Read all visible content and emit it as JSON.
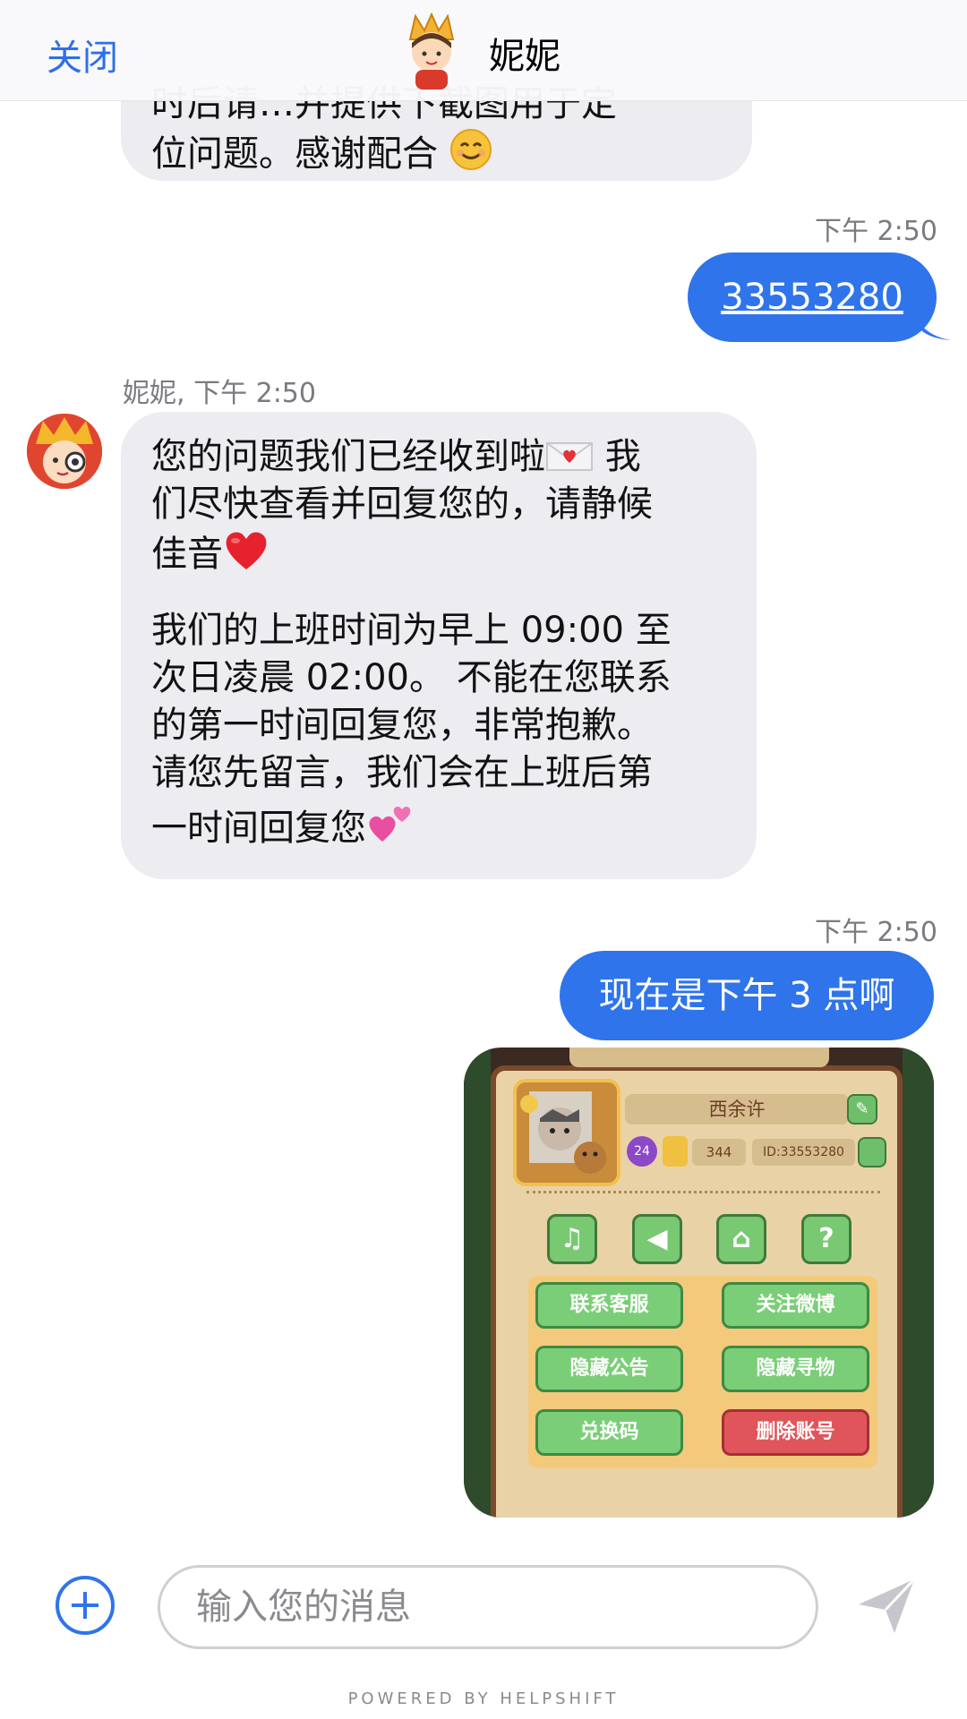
{
  "header": {
    "close_label": "关闭",
    "agent_name": "妮妮"
  },
  "messages": {
    "agent_1": {
      "partial_line": "时后请…并提供下截图用于定",
      "last_line": "位问题。感谢配合"
    },
    "user_1": {
      "time": "下午 2:50",
      "text": "33553280"
    },
    "agent_2": {
      "sender_time": "妮妮, 下午 2:50",
      "p1_line1": "您的问题我们已经收到啦",
      "p1_line1b": " 我",
      "p1_line2": "们尽快查看并回复您的，请静候",
      "p1_line3": "佳音",
      "p2_line1": "我们的上班时间为早上 09:00 至",
      "p2_line2": "次日凌晨 02:00。 不能在您联系",
      "p2_line3": "的第一时间回复您，非常抱歉。",
      "p2_line4": "请您先留言，我们会在上班后第",
      "p2_line5": "一时间回复您"
    },
    "user_2": {
      "time": "下午 2:50",
      "text": "现在是下午 3 点啊"
    }
  },
  "attachment": {
    "player_name": "西余许",
    "level": "24",
    "count": "344",
    "player_id": "ID:33553280",
    "buttons": {
      "contact_support": "联系客服",
      "follow_weibo": "关注微博",
      "hide_notice": "隐藏公告",
      "hide_find": "隐藏寻物",
      "redeem_code": "兑换码",
      "delete_account": "删除账号"
    },
    "help_glyph": "?"
  },
  "composer": {
    "placeholder": "输入您的消息"
  },
  "footer": {
    "powered_by": "POWERED BY HELPSHIFT"
  },
  "colors": {
    "accent": "#2f74ea",
    "agent_bubble": "#ececf1",
    "green_button": "#7bce78",
    "red_button": "#e0555b"
  }
}
